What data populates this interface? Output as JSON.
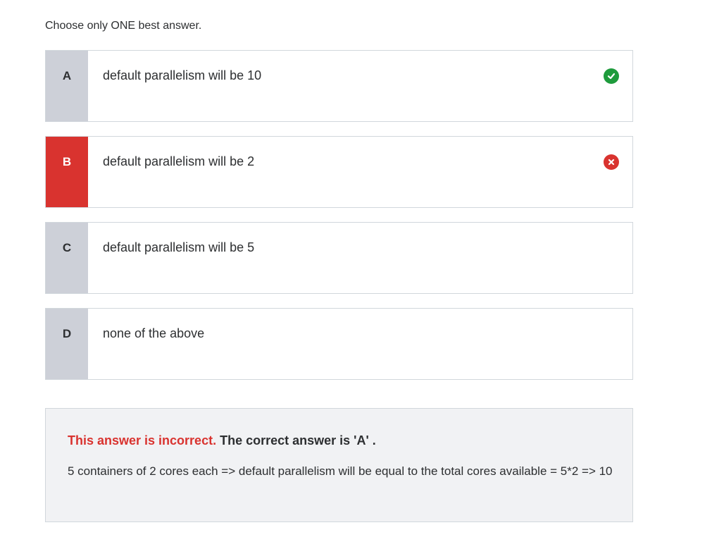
{
  "instruction": "Choose only ONE best answer.",
  "options": [
    {
      "letter": "A",
      "text": "default parallelism will be 10",
      "status": "correct",
      "status_icon": "check-circle-icon"
    },
    {
      "letter": "B",
      "text": "default parallelism will be 2",
      "status": "selected-wrong",
      "status_icon": "x-circle-icon"
    },
    {
      "letter": "C",
      "text": "default parallelism will be 5",
      "status": "none"
    },
    {
      "letter": "D",
      "text": "none of the above",
      "status": "none"
    }
  ],
  "feedback": {
    "incorrect_label": "This answer is incorrect.",
    "correct_answer_label": "The correct answer is 'A' .",
    "explanation": "5 containers of 2 cores each => default parallelism will be equal to the total cores available = 5*2 => 10"
  },
  "colors": {
    "correct": "#1e9b3c",
    "wrong": "#d9332f",
    "letter_bg": "#cdd0d8",
    "feedback_bg": "#f1f2f4"
  }
}
